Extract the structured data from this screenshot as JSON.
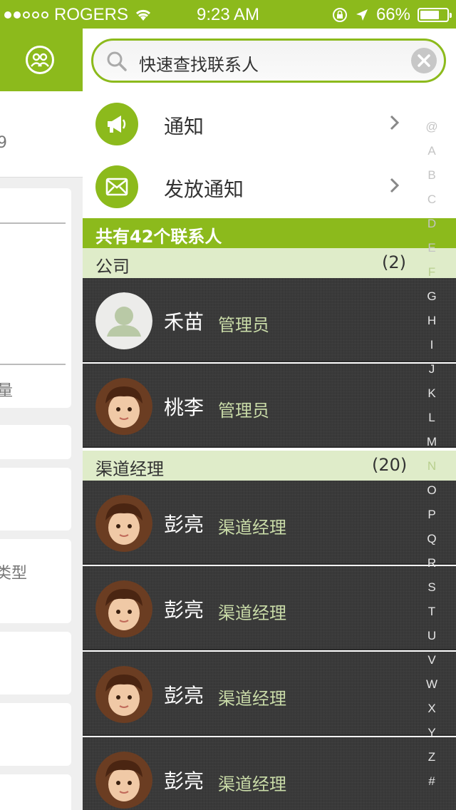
{
  "status_bar": {
    "carrier": "ROGERS",
    "time": "9:23 AM",
    "battery": "66%",
    "signal_filled": 2,
    "signal_total": 5
  },
  "left_panel": {
    "text_1": "9",
    "text_2": "量",
    "text_3": "类型"
  },
  "search": {
    "placeholder": "快速查找联系人"
  },
  "menu": [
    {
      "label": "通知",
      "icon": "megaphone-icon"
    },
    {
      "label": "发放通知",
      "icon": "envelope-icon"
    }
  ],
  "contacts_count_label": "共有42个联系人",
  "groups": [
    {
      "name": "公司",
      "count": "(2)",
      "contacts": [
        {
          "name": "禾苗",
          "role": "管理员",
          "avatar": "default-avatar"
        },
        {
          "name": "桃李",
          "role": "管理员",
          "avatar": "photo-avatar"
        }
      ]
    },
    {
      "name": "渠道经理",
      "count": "(20)",
      "contacts": [
        {
          "name": "彭亮",
          "role": "渠道经理",
          "avatar": "photo-avatar"
        },
        {
          "name": "彭亮",
          "role": "渠道经理",
          "avatar": "photo-avatar"
        },
        {
          "name": "彭亮",
          "role": "渠道经理",
          "avatar": "photo-avatar"
        },
        {
          "name": "彭亮",
          "role": "渠道经理",
          "avatar": "photo-avatar"
        }
      ]
    }
  ],
  "alphabet": [
    "@",
    "A",
    "B",
    "C",
    "D",
    "E",
    "F",
    "G",
    "H",
    "I",
    "J",
    "K",
    "L",
    "M",
    "N",
    "O",
    "P",
    "Q",
    "R",
    "S",
    "T",
    "U",
    "V",
    "W",
    "X",
    "Y",
    "Z",
    "#"
  ],
  "colors": {
    "accent": "#8cba1c",
    "group_header_bg": "#dfecc9",
    "contact_row_bg": "#3a3a3a",
    "role_text": "#c9dba8"
  }
}
